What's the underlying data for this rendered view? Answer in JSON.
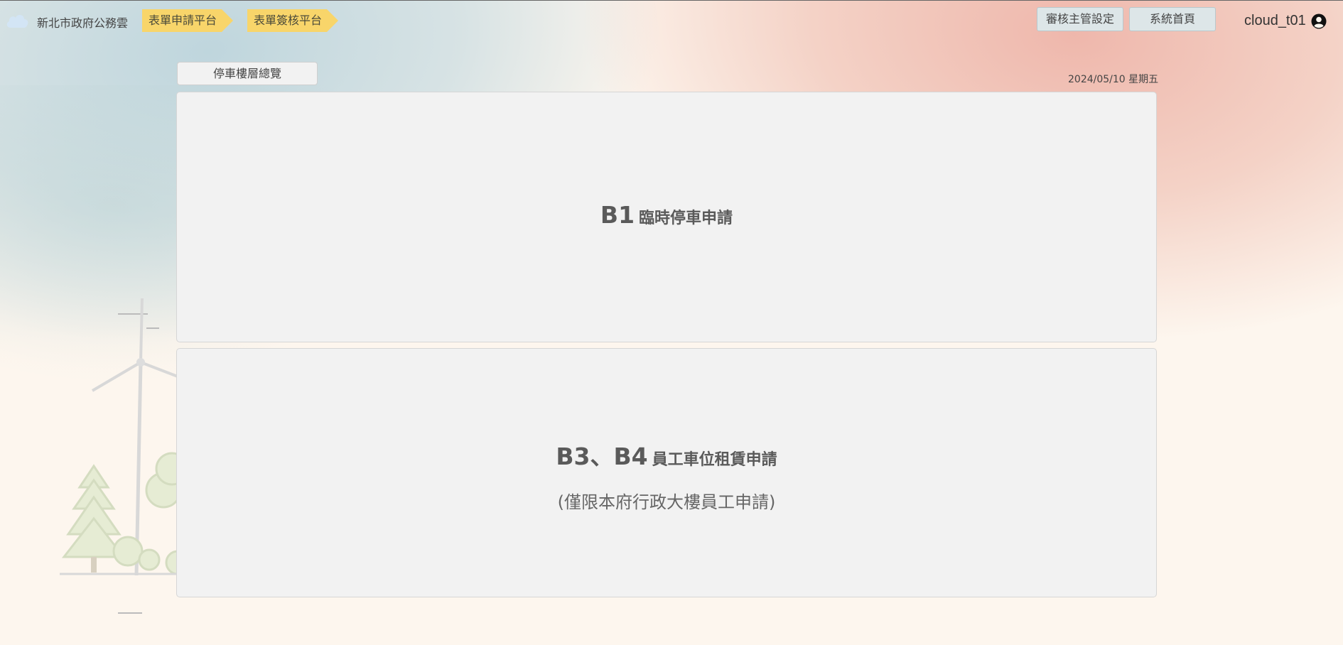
{
  "header": {
    "org_name": "新北市政府公務雲",
    "nav_tags": [
      "表單申請平台",
      "表單簽核平台"
    ],
    "buttons": [
      "審核主管設定",
      "系統首頁"
    ],
    "username": "cloud_t01"
  },
  "main": {
    "overview_button": "停車樓層總覽",
    "date": "2024/05/10 星期五",
    "cards": [
      {
        "code": "B1",
        "label": "臨時停車申請",
        "sub": ""
      },
      {
        "code": "B3、B4",
        "label": "員工車位租賃申請",
        "sub": "(僅限本府行政大樓員工申請)"
      }
    ]
  },
  "icons": {
    "logo": "cloud-icon",
    "user": "user-circle-icon"
  },
  "colors": {
    "tag": "#f8d56a",
    "card_bg": "#f2f2f2",
    "page_bg": "#fdf6ee",
    "button_bg": "#dde6e8"
  }
}
